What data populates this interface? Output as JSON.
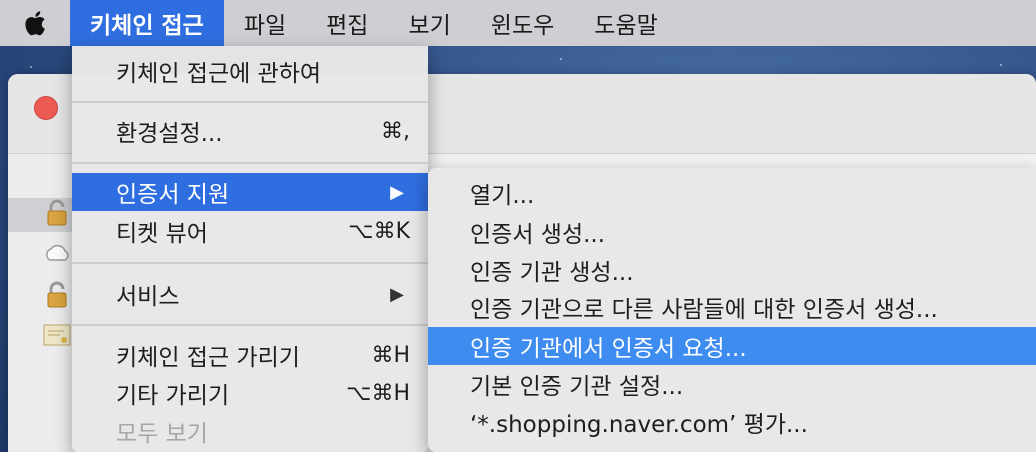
{
  "menubar": {
    "items": [
      {
        "label": "키체인 접근",
        "active": true
      },
      {
        "label": "파일"
      },
      {
        "label": "편집"
      },
      {
        "label": "보기"
      },
      {
        "label": "윈도우"
      },
      {
        "label": "도움말"
      }
    ]
  },
  "app_menu": {
    "items": [
      {
        "label": "키체인 접근에 관하여"
      },
      {
        "label": "환경설정...",
        "shortcut": "⌘,"
      },
      {
        "label": "인증서 지원",
        "submenu": "▶"
      },
      {
        "label": "티켓 뷰어",
        "shortcut": "⌥⌘K"
      },
      {
        "label": "서비스",
        "submenu": "▶"
      },
      {
        "label": "키체인 접근 가리기",
        "shortcut": "⌘H"
      },
      {
        "label": "기타 가리기",
        "shortcut": "⌥⌘H"
      },
      {
        "label": "모두 보기"
      }
    ]
  },
  "certificate_submenu": {
    "items": [
      {
        "label": "열기..."
      },
      {
        "label": "인증서 생성..."
      },
      {
        "label": "인증 기관 생성..."
      },
      {
        "label": "인증 기관으로 다른 사람들에 대한 인증서 생성..."
      },
      {
        "label": "인증 기관에서 인증서 요청..."
      },
      {
        "label": "기본 인증 기관 설정..."
      },
      {
        "label": "‘*.shopping.naver.com’ 평가..."
      }
    ]
  },
  "colors": {
    "menubar_bg": "#cfcfd3",
    "highlight": "#2f6ee0",
    "submenu_highlight": "#3f8cf0",
    "menu_bg": "#e8e8e8"
  },
  "icons": [
    "apple-icon",
    "lock-icon",
    "cloud-icon",
    "certificate-icon"
  ]
}
